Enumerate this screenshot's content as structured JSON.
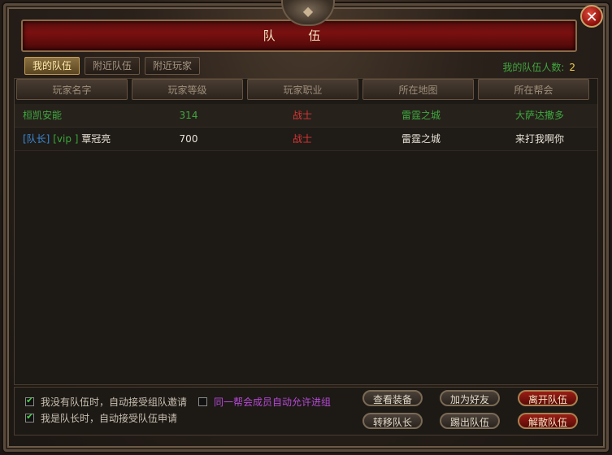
{
  "window": {
    "title": "队 伍",
    "close_symbol": "✕",
    "crest_icon": "dragon-crest-icon"
  },
  "tabs": [
    {
      "label": "我的队伍",
      "active": true
    },
    {
      "label": "附近队伍",
      "active": false
    },
    {
      "label": "附近玩家",
      "active": false
    }
  ],
  "team_count": {
    "label": "我的队伍人数:",
    "value": "2"
  },
  "columns": [
    "玩家名字",
    "玩家等级",
    "玩家职业",
    "所在地图",
    "所在帮会"
  ],
  "rows": [
    {
      "name": "桓凯安能",
      "level": "314",
      "job": "战士",
      "map": "雷霆之城",
      "guild": "大萨达撒多"
    },
    {
      "leader_tag": "[队长]",
      "vip_tag": "[vip ]",
      "name": "覃冠亮",
      "level": "700",
      "job": "战士",
      "map": "雷霆之城",
      "guild": "来打我啊你"
    }
  ],
  "options": [
    {
      "label": "我没有队伍时，自动接受组队邀请",
      "checked": true
    },
    {
      "label": "同一帮会成员自动允许进组",
      "checked": false
    },
    {
      "label": "我是队长时，自动接受队伍申请",
      "checked": true
    }
  ],
  "buttons": {
    "view_equipment": "查看装备",
    "add_friend": "加为好友",
    "leave_team": "离开队伍",
    "transfer_leader": "转移队长",
    "kick_member": "踢出队伍",
    "disband_team": "解散队伍"
  },
  "colors": {
    "accent_green": "#3fa83f",
    "job_red": "#d93636",
    "leader_blue": "#3a8ad6",
    "purple_option": "#b64ad6",
    "count_yellow": "#f2d24a"
  }
}
